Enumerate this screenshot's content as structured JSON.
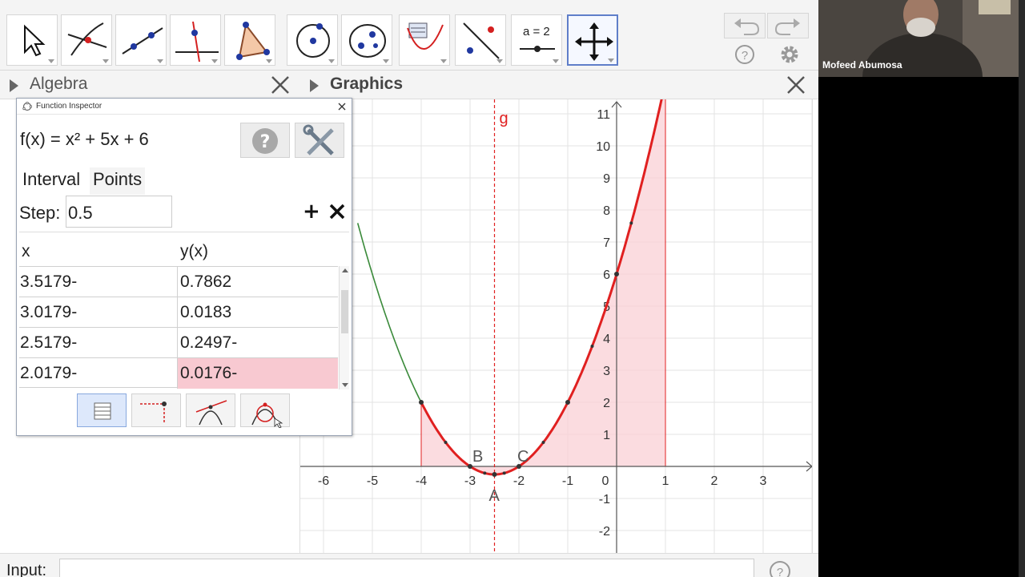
{
  "colors": {
    "curve": "#e02020",
    "curve_left": "#3a8a3a",
    "fill": "#f9d0d6",
    "grid": "#e3e3e3",
    "axis": "#555555",
    "highlight": "#f8c9d1",
    "active_tool": "#5f7ec9",
    "point": "#333333"
  },
  "toolbar": {
    "tools": [
      {
        "name": "move-tool",
        "icon": "cursor-arrow-icon"
      },
      {
        "name": "point-tool",
        "icon": "intersect-point-icon"
      },
      {
        "name": "line-tool",
        "icon": "line-through-points-icon"
      },
      {
        "name": "perpendicular-tool",
        "icon": "perpendicular-line-icon"
      },
      {
        "name": "polygon-tool",
        "icon": "polygon-icon"
      },
      {
        "name": "circle-tool",
        "icon": "circle-center-point-icon"
      },
      {
        "name": "conic-tool",
        "icon": "ellipse-icon"
      },
      {
        "name": "function-inspector-tool",
        "icon": "function-inspector-icon"
      },
      {
        "name": "reflect-tool",
        "icon": "reflect-icon"
      },
      {
        "name": "slider-tool",
        "icon": "slider-icon",
        "label": "a = 2"
      },
      {
        "name": "move-graphics-tool",
        "icon": "move-graphics-icon"
      }
    ]
  },
  "panels": {
    "algebra_title": "Algebra",
    "graphics_title": "Graphics"
  },
  "inspector": {
    "window_title": "Function Inspector",
    "function_text": "f(x) = x² + 5x + 6",
    "tabs": [
      "Interval",
      "Points"
    ],
    "active_tab": "Points",
    "step_label": "Step:",
    "step_value": "0.5",
    "columns": [
      "x",
      "y(x)"
    ],
    "rows": [
      {
        "x": "3.5179-",
        "y": "0.7862",
        "highlight": false
      },
      {
        "x": "3.0179-",
        "y": "0.0183",
        "highlight": false
      },
      {
        "x": "2.5179-",
        "y": "0.2497-",
        "highlight": false
      },
      {
        "x": "2.0179-",
        "y": "0.0176-",
        "highlight": true
      }
    ]
  },
  "graph": {
    "x_ticks": [
      "-6",
      "-5",
      "-4",
      "-3",
      "-2",
      "-1",
      "0",
      "1",
      "2",
      "3"
    ],
    "y_ticks": [
      "11",
      "10",
      "9",
      "8",
      "7",
      "6",
      "5",
      "4",
      "3",
      "2",
      "1",
      "-1",
      "-2"
    ],
    "line_label": "g",
    "point_labels": {
      "a": "A",
      "b": "B",
      "c": "C"
    }
  },
  "input": {
    "label": "Input:"
  },
  "video": {
    "participant_name": "Mofeed Abumosa"
  }
}
